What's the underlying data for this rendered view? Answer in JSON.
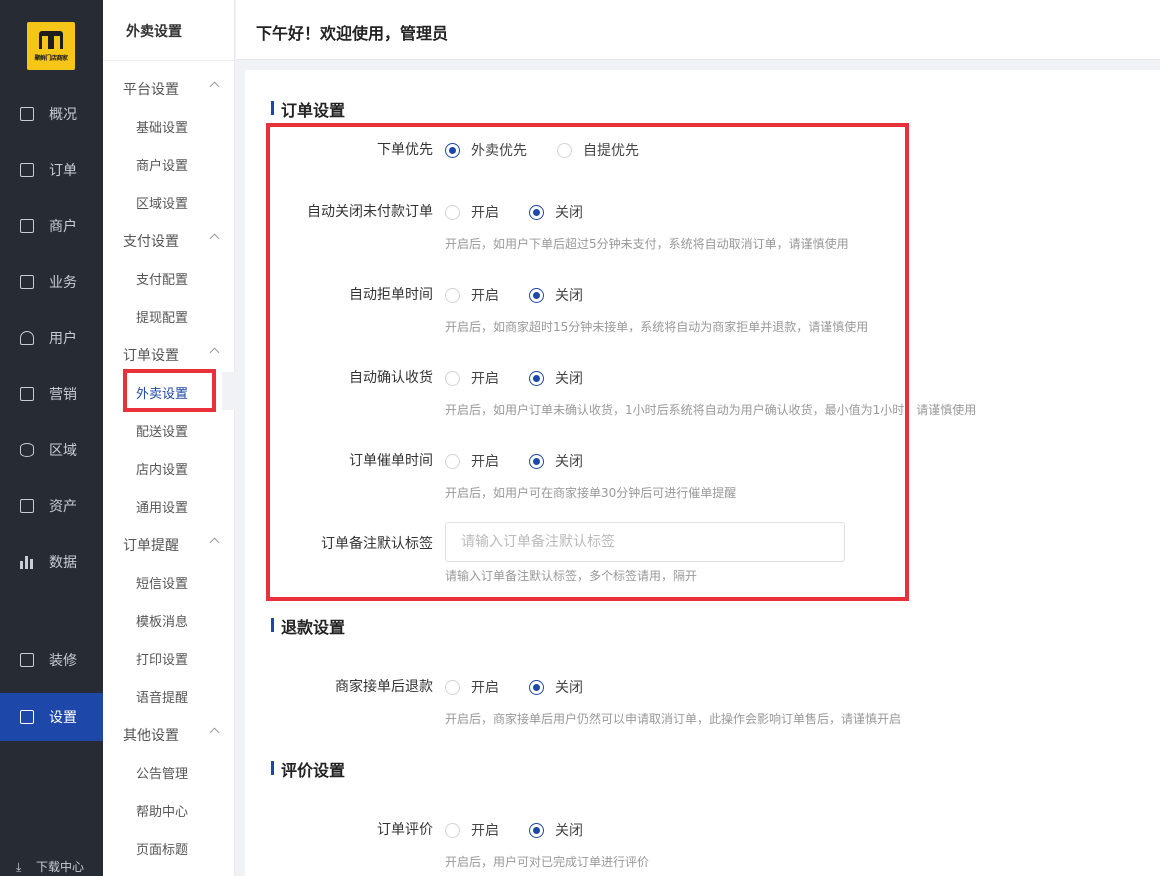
{
  "brand": {
    "logo_text": "聚鲜门店商家",
    "accent": "#1d47a8",
    "highlight": "#e8313a",
    "logo_color": "#f5c518"
  },
  "rail": {
    "items": [
      {
        "label": "概况",
        "icon": "monitor-icon"
      },
      {
        "label": "订单",
        "icon": "document-icon"
      },
      {
        "label": "商户",
        "icon": "building-icon"
      },
      {
        "label": "业务",
        "icon": "briefcase-icon"
      },
      {
        "label": "用户",
        "icon": "user-icon"
      },
      {
        "label": "营销",
        "icon": "gift-icon"
      },
      {
        "label": "区域",
        "icon": "database-icon"
      },
      {
        "label": "资产",
        "icon": "wallet-icon"
      },
      {
        "label": "数据",
        "icon": "bar-chart-icon"
      },
      {
        "label": "装修",
        "icon": "paint-icon"
      },
      {
        "label": "设置",
        "icon": "settings-icon"
      }
    ],
    "download": "下载中心"
  },
  "submenu": {
    "title": "外卖设置",
    "groups": [
      {
        "label": "平台设置",
        "items": [
          "基础设置",
          "商户设置",
          "区域设置"
        ]
      },
      {
        "label": "支付设置",
        "items": [
          "支付配置",
          "提现配置"
        ]
      },
      {
        "label": "订单设置",
        "items": [
          "外卖设置",
          "配送设置",
          "店内设置",
          "通用设置"
        ]
      },
      {
        "label": "订单提醒",
        "items": [
          "短信设置",
          "模板消息",
          "打印设置",
          "语音提醒"
        ]
      },
      {
        "label": "其他设置",
        "items": [
          "公告管理",
          "帮助中心",
          "页面标题"
        ]
      }
    ]
  },
  "header": {
    "greeting": "下午好！欢迎使用，管理员"
  },
  "sections": {
    "order": {
      "title": "订单设置",
      "priority": {
        "label": "下单优先",
        "opt1": "外卖优先",
        "opt2": "自提优先",
        "selected": "外卖优先"
      },
      "auto_close": {
        "label": "自动关闭未付款订单",
        "on": "开启",
        "off": "关闭",
        "selected": "关闭",
        "hint": "开启后，如用户下单后超过5分钟未支付，系统将自动取消订单，请谨慎使用"
      },
      "auto_reject": {
        "label": "自动拒单时间",
        "on": "开启",
        "off": "关闭",
        "selected": "关闭",
        "hint": "开启后，如商家超时15分钟未接单，系统将自动为商家拒单并退款，请谨慎使用"
      },
      "auto_confirm": {
        "label": "自动确认收货",
        "on": "开启",
        "off": "关闭",
        "selected": "关闭",
        "hint": "开启后，如用户订单未确认收货，1小时后系统将自动为用户确认收货，最小值为1小时，请谨慎使用"
      },
      "reminder": {
        "label": "订单催单时间",
        "on": "开启",
        "off": "关闭",
        "selected": "关闭",
        "hint": "开启后，如用户可在商家接单30分钟后可进行催单提醒"
      },
      "remark_tag": {
        "label": "订单备注默认标签",
        "value": "",
        "placeholder": "请输入订单备注默认标签",
        "hint": "请输入订单备注默认标签，多个标签请用，隔开"
      }
    },
    "refund": {
      "title": "退款设置",
      "after_accept": {
        "label": "商家接单后退款",
        "on": "开启",
        "off": "关闭",
        "selected": "关闭",
        "hint": "开启后，商家接单后用户仍然可以申请取消订单，此操作会影响订单售后，请谨慎开启"
      }
    },
    "review": {
      "title": "评价设置",
      "order_review": {
        "label": "订单评价",
        "on": "开启",
        "off": "关闭",
        "selected": "关闭",
        "hint": "开启后，用户可对已完成订单进行评价"
      }
    }
  }
}
